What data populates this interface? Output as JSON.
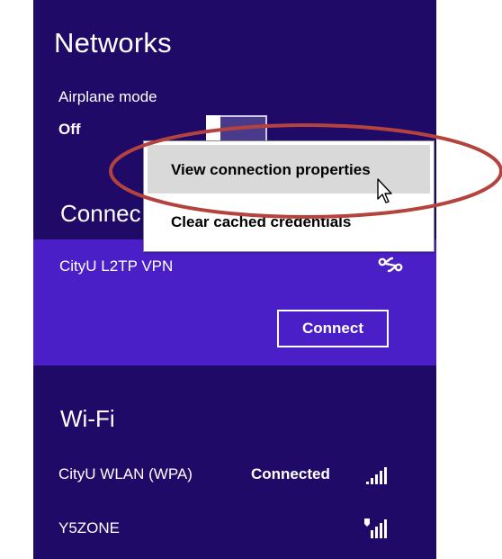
{
  "panel": {
    "title": "Networks",
    "airplane_mode": {
      "label": "Airplane mode",
      "value": "Off"
    },
    "connections_heading": "Connec",
    "vpn": {
      "name": "CityU L2TP VPN",
      "icon": "vpn-link-icon",
      "connect_label": "Connect"
    },
    "wifi_heading": "Wi-Fi",
    "wifi_networks": [
      {
        "name": "CityU WLAN (WPA)",
        "status": "Connected",
        "icon": "wifi-signal-icon"
      },
      {
        "name": "Y5ZONE",
        "status": "",
        "icon": "wifi-shield-signal-icon"
      }
    ]
  },
  "context_menu": {
    "items": [
      {
        "label": "View connection properties"
      },
      {
        "label": "Clear cached credentials"
      }
    ]
  },
  "colors": {
    "panel_bg": "#1f0a68",
    "selected_row_bg": "#4a1fc8",
    "annotation_ellipse": "#b5433d",
    "menu_highlight": "#d9d9d9"
  }
}
